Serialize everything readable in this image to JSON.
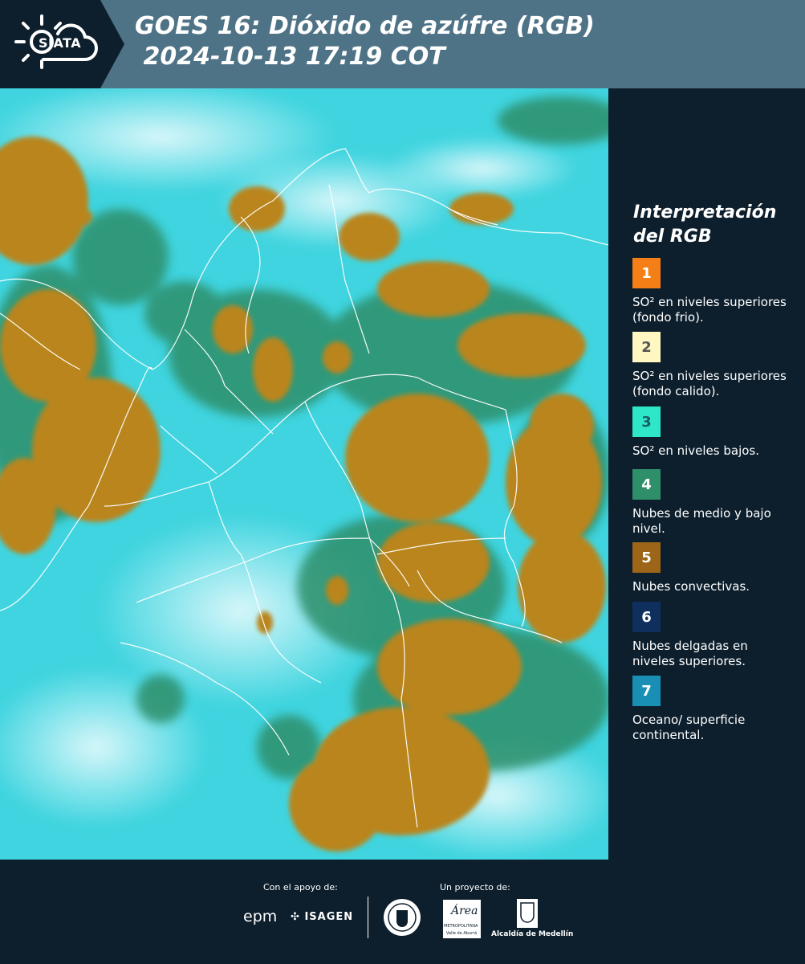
{
  "header": {
    "logo_text": "SIATA",
    "title_line1": "GOES 16: Dióxido de azúfre (RGB)",
    "title_line2": " 2024-10-13 17:19 COT"
  },
  "legend": {
    "title": "Interpretación del RGB",
    "items": [
      {
        "number": "1",
        "color": "#f57f17",
        "number_color": "#ffffff",
        "label": "SO² en niveles superiores (fondo frio)."
      },
      {
        "number": "2",
        "color": "#fff6c2",
        "number_color": "#555555",
        "label": "SO² en niveles superiores (fondo calido)."
      },
      {
        "number": "3",
        "color": "#2ee6c8",
        "number_color": "#1a5e66",
        "label": "SO² en niveles bajos."
      },
      {
        "number": "4",
        "color": "#2e8f6a",
        "number_color": "#ffffff",
        "label": "Nubes de medio y bajo nivel."
      },
      {
        "number": "5",
        "color": "#9c6518",
        "number_color": "#ffffff",
        "label": "Nubes convectivas."
      },
      {
        "number": "6",
        "color": "#0f2f5e",
        "number_color": "#ffffff",
        "label": "Nubes delgadas en niveles superiores."
      },
      {
        "number": "7",
        "color": "#1a8fb5",
        "number_color": "#ffffff",
        "label": "Oceano/ superficie continental."
      }
    ]
  },
  "footer": {
    "support_label": "Con el apoyo de:",
    "project_label": "Un proyecto de:",
    "epm": "epm",
    "isagen": "ISAGEN",
    "metropolitana_top": "Área",
    "metropolitana_bottom": "METROPOLITANA",
    "metropolitana_sub": "Valle de Aburrá",
    "alcaldia": "Alcaldía de Medellín"
  },
  "map": {
    "ocean_color": "#3fd4df",
    "cloud_color": "#b9851f",
    "mid_cloud_color": "#2e8f6a",
    "border_color": "#ffffff"
  }
}
